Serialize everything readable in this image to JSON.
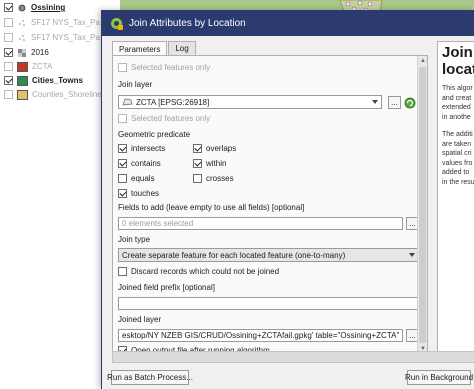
{
  "layers_panel": {
    "items": [
      {
        "label": "Ossining",
        "checked": true,
        "style": "bold",
        "icon": "point-layer-icon"
      },
      {
        "label": "SF17 NYS_Tax_Pa",
        "checked": false,
        "style": "grey",
        "icon": "point-layer-icon"
      },
      {
        "label": "SF17 NYS_Tax_Pa",
        "checked": false,
        "style": "grey",
        "icon": "point-layer-icon"
      },
      {
        "label": "2016",
        "checked": true,
        "style": "normal",
        "icon": "raster-layer-icon"
      },
      {
        "label": "ZCTA",
        "checked": false,
        "style": "grey",
        "icon": "polygon-swatch-icon",
        "color": "#c0392b"
      },
      {
        "label": "Cities_Towns",
        "checked": true,
        "style": "bold",
        "icon": "polygon-swatch-icon",
        "color": "#2e8b57"
      },
      {
        "label": "Counties_Shoreline",
        "checked": false,
        "style": "grey",
        "icon": "polygon-swatch-icon",
        "color": "#e2c16b"
      }
    ]
  },
  "dialog": {
    "title": "Join Attributes by Location",
    "tabs": [
      {
        "label": "Parameters",
        "active": true
      },
      {
        "label": "Log",
        "active": false
      }
    ],
    "params": {
      "selected_features_only_1": "Selected features only",
      "join_layer_label": "Join layer",
      "join_layer_value": "ZCTA [EPSG:26918]",
      "selected_features_only_2": "Selected features only",
      "geometric_predicate_label": "Geometric predicate",
      "predicates": [
        {
          "label": "intersects",
          "checked": true
        },
        {
          "label": "overlaps",
          "checked": true
        },
        {
          "label": "contains",
          "checked": true
        },
        {
          "label": "within",
          "checked": true
        },
        {
          "label": "equals",
          "checked": false
        },
        {
          "label": "crosses",
          "checked": false
        },
        {
          "label": "touches",
          "checked": true
        }
      ],
      "fields_label": "Fields to add (leave empty to use all fields) [optional]",
      "fields_value": "0 elements selected",
      "join_type_label": "Join type",
      "join_type_value": "Create separate feature for each located feature (one-to-many)",
      "discard_label": "Discard records which could not be joined",
      "discard_checked": false,
      "prefix_label": "Joined field prefix [optional]",
      "prefix_value": "",
      "joined_layer_label": "Joined layer",
      "joined_layer_value": "esktop/NY NZEB GIS/CRUD/Ossining+ZCTAfail.gpkg' table=\"Ossining+ZCTA\" (geom) sql=",
      "open_output_label": "Open output file after running algorithm",
      "open_output_checked": true,
      "dots": "..."
    },
    "help": {
      "title_lines": [
        "Join a",
        "locati"
      ],
      "para1": [
        "This algor",
        "and creat",
        "extended",
        "in anothe"
      ],
      "para2": [
        "The additi",
        "are taken",
        "spatial cri",
        "values fro",
        "added to",
        "in the resu"
      ]
    },
    "buttons": {
      "batch": "Run as Batch Process...",
      "run_bg": "Run in Background"
    }
  },
  "colors": {
    "title_bar": "#2b3a6f",
    "map_base": "#a8c88a"
  }
}
